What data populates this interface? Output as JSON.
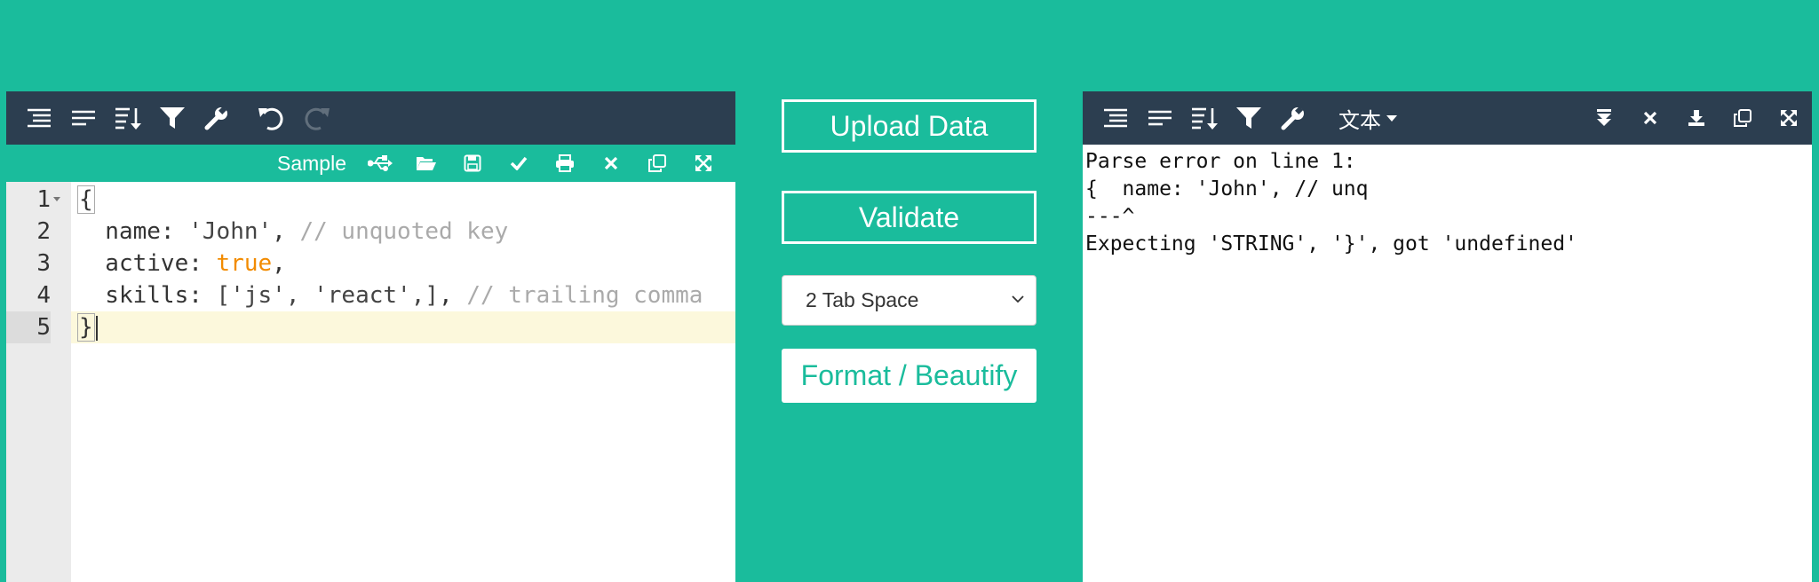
{
  "left_editor": {
    "sample_label": "Sample",
    "lines": [
      {
        "num": "1",
        "text": "{"
      },
      {
        "num": "2",
        "key": "  name: ",
        "value": "'John'",
        "sep": ", ",
        "comment": "// unquoted key"
      },
      {
        "num": "3",
        "key": "  active: ",
        "value": "true",
        "sep": ",",
        "comment": ""
      },
      {
        "num": "4",
        "key": "  skills: ",
        "value": "['js', 'react',]",
        "sep": ", ",
        "comment": "// trailing comma"
      },
      {
        "num": "5",
        "text": "}"
      }
    ],
    "active_line": "5"
  },
  "controls": {
    "upload_label": "Upload Data",
    "validate_label": "Validate",
    "indent_selected": "2 Tab Space",
    "format_label": "Format / Beautify"
  },
  "right_panel": {
    "mode_label": "文本",
    "output_lines": [
      "Parse error on line 1:",
      "{  name: 'John', // unq",
      "---^",
      "Expecting 'STRING', '}', got 'undefined'"
    ]
  },
  "icons": {
    "left_toolbar": [
      "format-icon",
      "compact-icon",
      "sort-icon",
      "filter-icon",
      "repair-icon",
      "undo-icon",
      "redo-icon"
    ],
    "left_subbar": [
      "usb-icon",
      "folder-open-icon",
      "save-icon",
      "check-icon",
      "print-icon",
      "close-icon",
      "copy-icon",
      "expand-icon"
    ],
    "right_toolbar": [
      "format-icon",
      "compact-icon",
      "sort-icon",
      "filter-icon",
      "repair-icon"
    ],
    "right_actions": [
      "move-down-icon",
      "close-icon",
      "download-icon",
      "copy-icon",
      "expand-icon"
    ]
  },
  "colors": {
    "background": "#1abc9c",
    "toolbar": "#2c3e50",
    "keyword": "#f28b00",
    "comment": "#aaaaaa",
    "active_line": "#fcf8dc"
  }
}
